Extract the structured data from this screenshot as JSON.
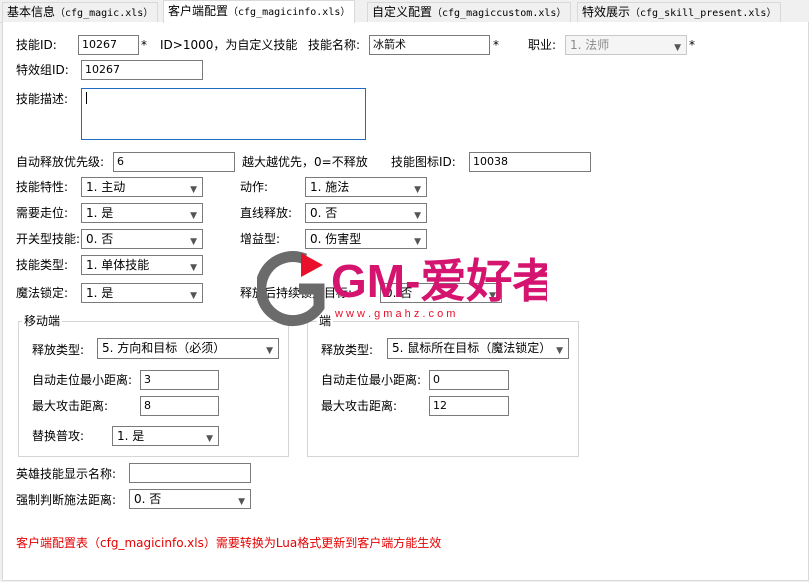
{
  "tabs": [
    {
      "label": "基本信息",
      "file": "（cfg_magic.xls）"
    },
    {
      "label": "客户端配置",
      "file": "（cfg_magicinfo.xls）"
    },
    {
      "label": "自定义配置",
      "file": "（cfg_magiccustom.xls）"
    },
    {
      "label": "特效展示",
      "file": "（cfg_skill_present.xls）"
    }
  ],
  "active_tab": 1,
  "form": {
    "skill_id": {
      "label": "技能ID:",
      "value": "10267",
      "star": "*",
      "hint": "ID>1000，为自定义技能"
    },
    "skill_name": {
      "label": "技能名称:",
      "value": "冰箭术",
      "star": "*"
    },
    "profession": {
      "label": "职业:",
      "value": "1. 法师",
      "star": "*"
    },
    "effect_group_id": {
      "label": "特效组ID:",
      "value": "10267"
    },
    "skill_desc": {
      "label": "技能描述:",
      "value": ""
    },
    "auto_priority": {
      "label": "自动释放优先级:",
      "value": "6",
      "hint": "越大越优先，0=不释放"
    },
    "skill_icon_id": {
      "label": "技能图标ID:",
      "value": "10038"
    },
    "skill_attr": {
      "label": "技能特性:",
      "value": "1. 主动"
    },
    "action": {
      "label": "动作:",
      "value": "1. 施法"
    },
    "need_walk": {
      "label": "需要走位:",
      "value": "1. 是"
    },
    "line_release": {
      "label": "直线释放:",
      "value": "0. 否"
    },
    "switch_skill": {
      "label": "开关型技能:",
      "value": "0. 否"
    },
    "buff_type": {
      "label": "增益型:",
      "value": "0. 伤害型"
    },
    "skill_type": {
      "label": "技能类型:",
      "value": "1. 单体技能"
    },
    "magic_lock": {
      "label": "魔法锁定:",
      "value": "1. 是"
    },
    "release_target": {
      "label": "释放后持续锁定目标:",
      "value": "0. 否"
    }
  },
  "mobile": {
    "title": "移动端",
    "release_type": {
      "label": "释放类型:",
      "value": "5. 方向和目标（必须）"
    },
    "auto_walk_min": {
      "label": "自动走位最小距离:",
      "value": "3"
    },
    "max_attack": {
      "label": "最大攻击距离:",
      "value": "8"
    },
    "replace_normal": {
      "label": "替换普攻:",
      "value": "1. 是"
    }
  },
  "pc": {
    "title": "端",
    "release_type": {
      "label": "释放类型:",
      "value": "5. 鼠标所在目标（魔法锁定）"
    },
    "auto_walk_min": {
      "label": "自动走位最小距离:",
      "value": "0"
    },
    "max_attack": {
      "label": "最大攻击距离:",
      "value": "12"
    }
  },
  "hero_skill_name": {
    "label": "英雄技能显示名称:",
    "value": ""
  },
  "force_cast_distance": {
    "label": "强制判断施法距离:",
    "value": "0. 否"
  },
  "footer_note": "客户端配置表（cfg_magicinfo.xls）需要转换为Lua格式更新到客户端方能生效",
  "watermark": {
    "text": "GM-爱好者",
    "url": "w w w . g m a h z . c o m",
    "colors": {
      "gray": "#6b6b6b",
      "red": "#e8102a",
      "magenta": "#d4146e"
    }
  }
}
